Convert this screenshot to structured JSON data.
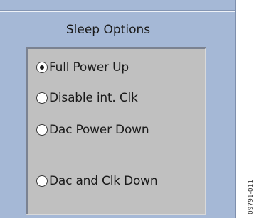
{
  "group": {
    "title": "Sleep Options",
    "options": [
      {
        "label": "Full Power Up",
        "selected": true
      },
      {
        "label": "Disable int. Clk",
        "selected": false
      },
      {
        "label": "Dac Power Down",
        "selected": false
      },
      {
        "label": "Dac and Clk Down",
        "selected": false
      }
    ]
  },
  "figure_id": "09791-011",
  "colors": {
    "panel_bg": "#a5b8d6",
    "group_bg": "#c0c0c0"
  }
}
